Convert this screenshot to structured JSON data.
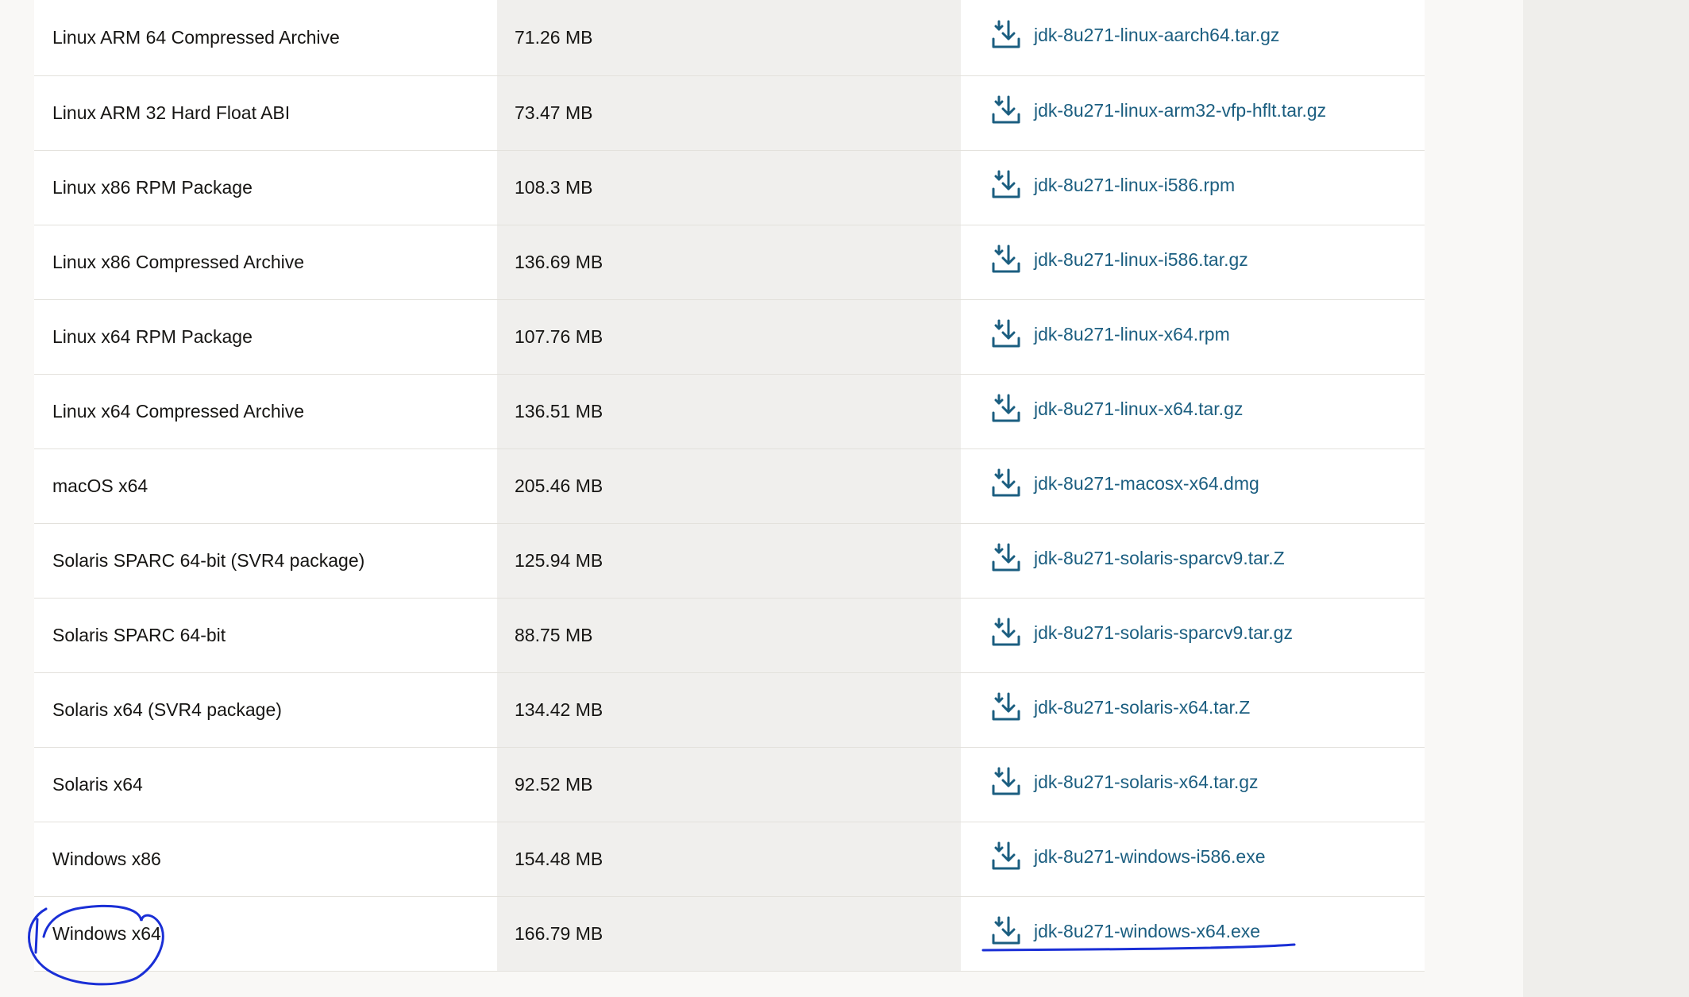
{
  "downloads": {
    "rows": [
      {
        "product": "Linux ARM 64 Compressed Archive",
        "size": "71.26 MB",
        "file": "jdk-8u271-linux-aarch64.tar.gz"
      },
      {
        "product": "Linux ARM 32 Hard Float ABI",
        "size": "73.47 MB",
        "file": "jdk-8u271-linux-arm32-vfp-hflt.tar.gz"
      },
      {
        "product": "Linux x86 RPM Package",
        "size": "108.3 MB",
        "file": "jdk-8u271-linux-i586.rpm"
      },
      {
        "product": "Linux x86 Compressed Archive",
        "size": "136.69 MB",
        "file": "jdk-8u271-linux-i586.tar.gz"
      },
      {
        "product": "Linux x64 RPM Package",
        "size": "107.76 MB",
        "file": "jdk-8u271-linux-x64.rpm"
      },
      {
        "product": "Linux x64 Compressed Archive",
        "size": "136.51 MB",
        "file": "jdk-8u271-linux-x64.tar.gz"
      },
      {
        "product": "macOS x64",
        "size": "205.46 MB",
        "file": "jdk-8u271-macosx-x64.dmg"
      },
      {
        "product": "Solaris SPARC 64-bit (SVR4 package)",
        "size": "125.94 MB",
        "file": "jdk-8u271-solaris-sparcv9.tar.Z"
      },
      {
        "product": "Solaris SPARC 64-bit",
        "size": "88.75 MB",
        "file": "jdk-8u271-solaris-sparcv9.tar.gz"
      },
      {
        "product": "Solaris x64 (SVR4 package)",
        "size": "134.42 MB",
        "file": "jdk-8u271-solaris-x64.tar.Z"
      },
      {
        "product": "Solaris x64",
        "size": "92.52 MB",
        "file": "jdk-8u271-solaris-x64.tar.gz"
      },
      {
        "product": "Windows x86",
        "size": "154.48 MB",
        "file": "jdk-8u271-windows-i586.exe"
      },
      {
        "product": "Windows x64",
        "size": "166.79 MB",
        "file": "jdk-8u271-windows-x64.exe"
      }
    ],
    "icon": "download-icon",
    "link_color": "#1b5e80",
    "annotation_color": "#1a2fd6"
  }
}
